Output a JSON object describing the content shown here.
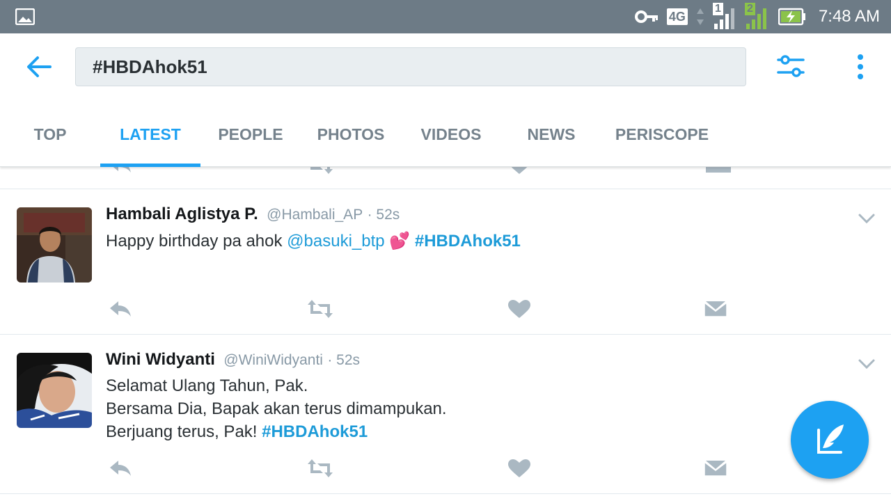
{
  "status_bar": {
    "time": "7:48 AM",
    "network": "4G",
    "sim1": "1",
    "sim2": "2",
    "icons": [
      "gallery-icon",
      "key-icon",
      "signal-icon",
      "battery-charging-icon"
    ]
  },
  "search": {
    "query": "#HBDAhok51"
  },
  "tabs": [
    {
      "label": "TOP"
    },
    {
      "label": "LATEST",
      "active": true
    },
    {
      "label": "PEOPLE"
    },
    {
      "label": "PHOTOS"
    },
    {
      "label": "VIDEOS"
    },
    {
      "label": "NEWS"
    },
    {
      "label": "PERISCOPE"
    }
  ],
  "tweets": [
    {
      "name": "Hambali Aglistya P.",
      "handle": "@Hambali_AP",
      "time": "· 52s",
      "text_plain": "Happy birthday pa ahok ",
      "mention": "@basuki_btp",
      "emoji": "💕",
      "hashtag": "#HBDAhok51"
    },
    {
      "name": "Wini Widyanti",
      "handle": "@WiniWidyanti",
      "time": "· 52s",
      "line1": "Selamat Ulang Tahun, Pak.",
      "line2": "Bersama Dia, Bapak akan terus dimampukan.",
      "line3_plain": "Berjuang terus, Pak! ",
      "hashtag": "#HBDAhok51"
    }
  ],
  "colors": {
    "accent": "#1da1f2",
    "status_bar": "#6d7b86",
    "inactive_tab": "#75828c",
    "action_icon": "#aab8c2"
  }
}
